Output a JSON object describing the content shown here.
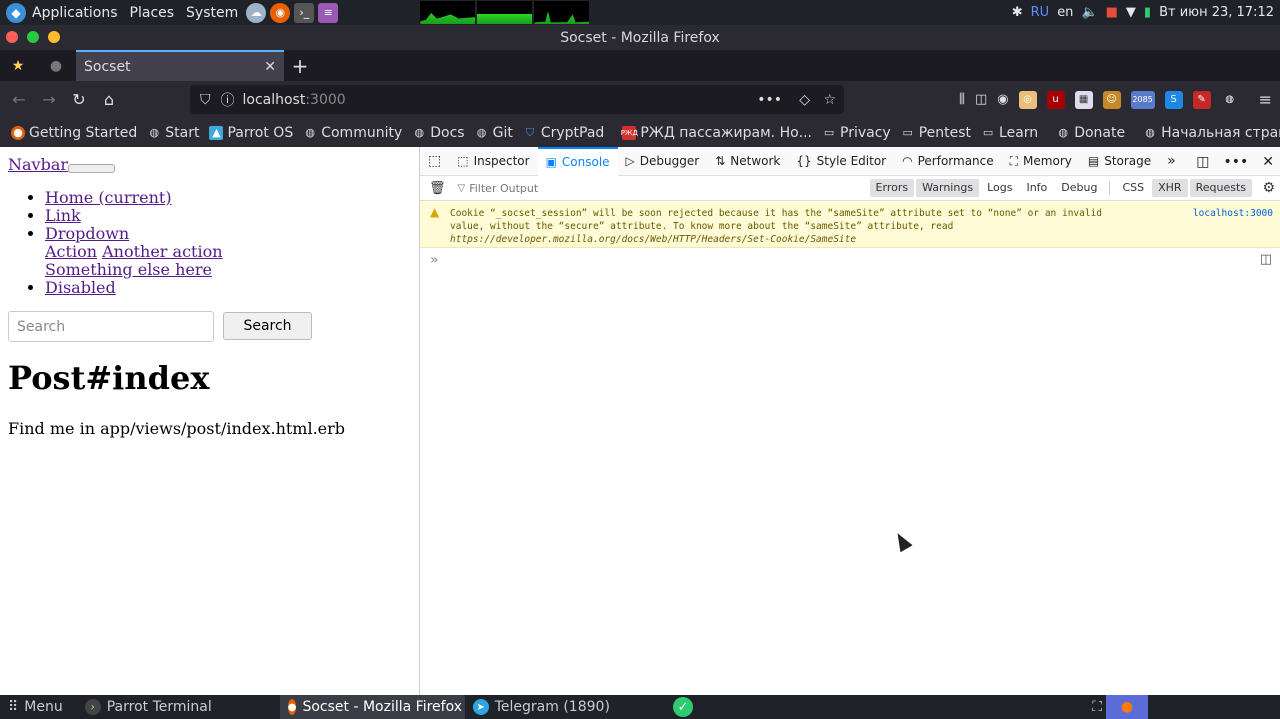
{
  "os_bar": {
    "applications": "Applications",
    "places": "Places",
    "system": "System",
    "lang_ru": "RU",
    "lang_en": "en",
    "datetime": "Вт июн 23, 17:12"
  },
  "window": {
    "title": "Socset - Mozilla Firefox"
  },
  "tabs": [
    {
      "label": "Socset"
    }
  ],
  "urlbar": {
    "host": "localhost",
    "port": ":3000"
  },
  "extensions": {
    "badge_count": "2085"
  },
  "bookmarks": [
    {
      "label": "Getting Started",
      "icon": "firefox-icon"
    },
    {
      "label": "Start",
      "icon": "globe-icon"
    },
    {
      "label": "Parrot OS",
      "icon": "parrot-icon"
    },
    {
      "label": "Community",
      "icon": "globe-icon"
    },
    {
      "label": "Docs",
      "icon": "globe-icon"
    },
    {
      "label": "Git",
      "icon": "globe-icon"
    },
    {
      "label": "CryptPad",
      "icon": "cryptpad-icon"
    },
    {
      "label": "РЖД пассажирам. Но...",
      "icon": "rzd-icon"
    },
    {
      "label": "Privacy",
      "icon": "folder-icon"
    },
    {
      "label": "Pentest",
      "icon": "folder-icon"
    },
    {
      "label": "Learn",
      "icon": "folder-icon"
    },
    {
      "label": "Donate",
      "icon": "globe-icon"
    },
    {
      "label": "Начальная страница",
      "icon": "globe-icon"
    }
  ],
  "page": {
    "brand": "Navbar",
    "nav_items": [
      "Home (current)",
      "Link",
      "Dropdown",
      "Disabled"
    ],
    "dropdown_items": [
      "Action",
      "Another action",
      "Something else here"
    ],
    "search_placeholder": "Search",
    "search_button": "Search",
    "heading": "Post#index",
    "paragraph": "Find me in app/views/post/index.html.erb"
  },
  "devtools": {
    "tabs": [
      "Inspector",
      "Console",
      "Debugger",
      "Network",
      "Style Editor",
      "Performance",
      "Memory",
      "Storage"
    ],
    "active_tab": "Console",
    "filter_placeholder": "Filter Output",
    "filters": [
      "Errors",
      "Warnings",
      "Logs",
      "Info",
      "Debug",
      "CSS",
      "XHR",
      "Requests"
    ],
    "warning": {
      "line1": "Cookie “_socset_session” will be soon rejected because it has the “sameSite” attribute set to “none” or an invalid",
      "line2": "value, without the “secure” attribute. To know more about the “sameSite” attribute, read",
      "url": "https://developer.mozilla.org/docs/Web/HTTP/Headers/Set-Cookie/SameSite",
      "location": "localhost:3000"
    }
  },
  "taskbar": {
    "menu": "Menu",
    "items": [
      {
        "label": "Parrot Terminal",
        "active": false
      },
      {
        "label": "Socset - Mozilla Firefox",
        "active": true
      },
      {
        "label": "Telegram (1890)",
        "active": false
      }
    ]
  }
}
